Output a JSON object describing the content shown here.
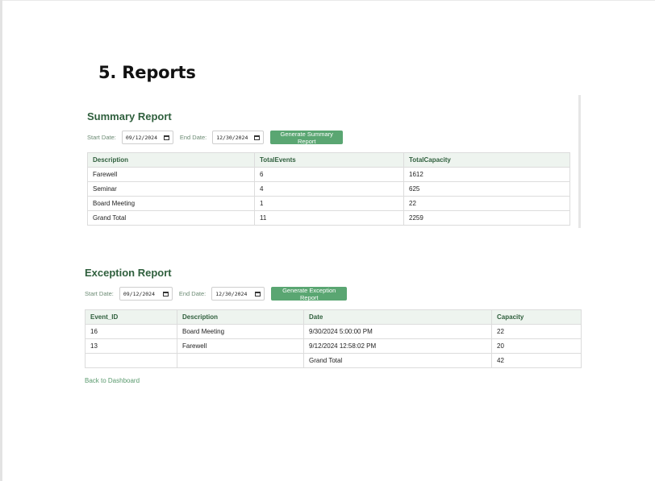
{
  "page": {
    "heading": "5. Reports"
  },
  "summary": {
    "title": "Summary Report",
    "start_label": "Start Date:",
    "start_value": "09/12/2024",
    "end_label": "End Date:",
    "end_value": "12/30/2024",
    "button": "Generate Summary Report",
    "columns": [
      "Description",
      "TotalEvents",
      "TotalCapacity"
    ],
    "rows": [
      [
        "Farewell",
        "6",
        "1612"
      ],
      [
        "Seminar",
        "4",
        "625"
      ],
      [
        "Board Meeting",
        "1",
        "22"
      ],
      [
        "Grand Total",
        "11",
        "2259"
      ]
    ]
  },
  "exception": {
    "title": "Exception Report",
    "start_label": "Start Date:",
    "start_value": "09/12/2024",
    "end_label": "End Date:",
    "end_value": "12/30/2024",
    "button": "Generate Exception Report",
    "columns": [
      "Event_ID",
      "Description",
      "Date",
      "Capacity"
    ],
    "rows": [
      [
        "16",
        "Board Meeting",
        "9/30/2024 5:00:00 PM",
        "22"
      ],
      [
        "13",
        "Farewell",
        "9/12/2024 12:58:02 PM",
        "20"
      ],
      [
        "",
        "",
        "Grand Total",
        "42"
      ]
    ]
  },
  "back_link": "Back to Dashboard",
  "colors": {
    "accent": "#5aa672",
    "heading": "#2f5f3d",
    "header_bg": "#eef4ef"
  }
}
